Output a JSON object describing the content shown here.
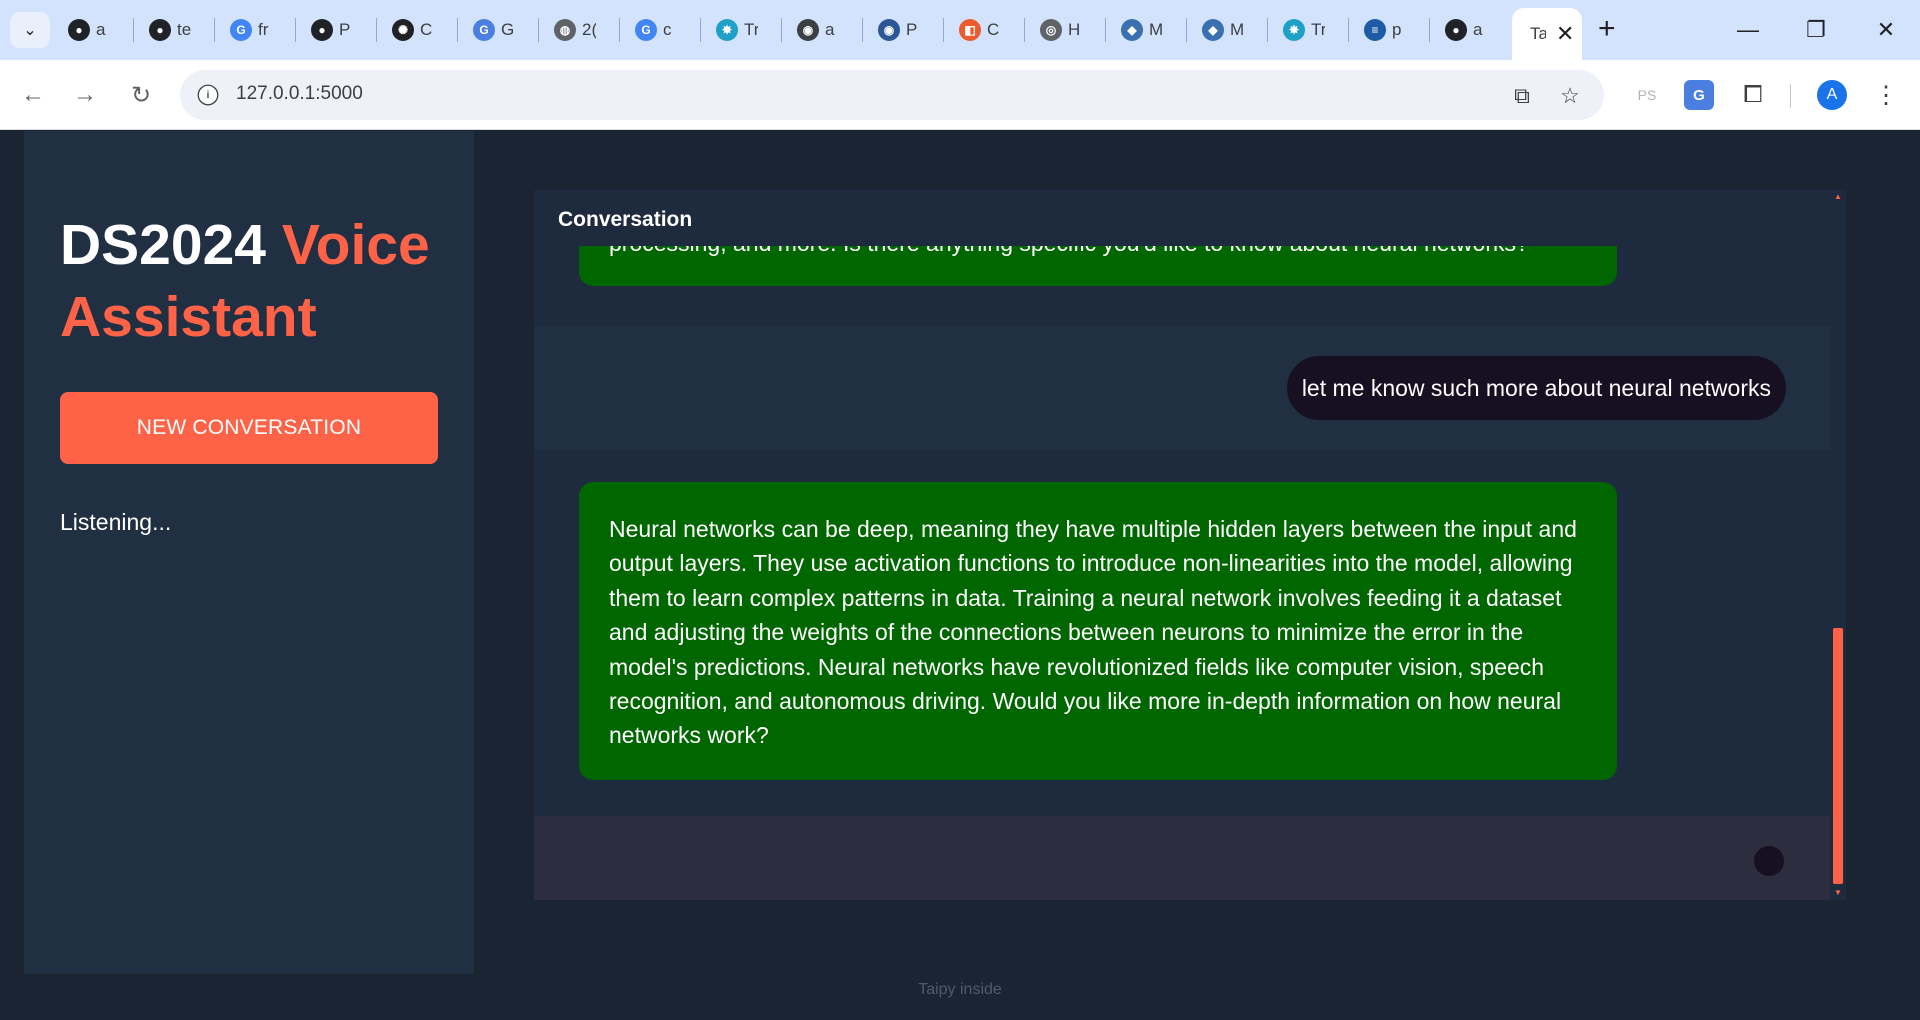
{
  "browser": {
    "tabs": [
      {
        "label": "a",
        "icon": "github-icon",
        "color": "#1f2328"
      },
      {
        "label": "te",
        "icon": "github-icon",
        "color": "#1f2328"
      },
      {
        "label": "fr",
        "icon": "google-icon",
        "color": "#4285f4"
      },
      {
        "label": "P",
        "icon": "github-icon",
        "color": "#1f2328"
      },
      {
        "label": "C",
        "icon": "openai-icon",
        "color": "#202124"
      },
      {
        "label": "G",
        "icon": "translate-icon",
        "color": "#4a7fe0"
      },
      {
        "label": "2(",
        "icon": "globe-icon",
        "color": "#5f6368"
      },
      {
        "label": "c",
        "icon": "google-icon",
        "color": "#4285f4"
      },
      {
        "label": "Tr",
        "icon": "spark-icon",
        "color": "#1fa0c9"
      },
      {
        "label": "a",
        "icon": "generic-icon",
        "color": "#3c4043"
      },
      {
        "label": "P",
        "icon": "generic-icon",
        "color": "#2b5797"
      },
      {
        "label": "C",
        "icon": "office-icon",
        "color": "#eb5b2b"
      },
      {
        "label": "H",
        "icon": "chrome-icon",
        "color": "#5f6368"
      },
      {
        "label": "M",
        "icon": "robot-icon",
        "color": "#3a6fb0"
      },
      {
        "label": "M",
        "icon": "robot-icon",
        "color": "#3a6fb0"
      },
      {
        "label": "Tr",
        "icon": "spark-icon",
        "color": "#1fa0c9"
      },
      {
        "label": "p",
        "icon": "stackoverflow-icon",
        "color": "#1f5aa6"
      },
      {
        "label": "a",
        "icon": "github-icon",
        "color": "#1f2328"
      }
    ],
    "active_tab": {
      "label": "Ta"
    },
    "url": "127.0.0.1:5000",
    "ext_faded": "PS",
    "profile_initial": "A"
  },
  "app": {
    "title_main": "DS2024",
    "title_accent": "Voice Assistant",
    "new_conversation_label": "NEW CONVERSATION",
    "status": "Listening..."
  },
  "conversation": {
    "title": "Conversation",
    "messages": [
      {
        "role": "assistant",
        "text": "processing, and more. Is there anything specific you'd like to know about neural networks?"
      },
      {
        "role": "user",
        "text": "let me know such more about neural networks"
      },
      {
        "role": "assistant",
        "text": "Neural networks can be deep, meaning they have multiple hidden layers between the input and output layers. They use activation functions to introduce non-linearities into the model, allowing them to learn complex patterns in data. Training a neural network involves feeding it a dataset and adjusting the weights of the connections between neurons to minimize the error in the model's predictions. Neural networks have revolutionized fields like computer vision, speech recognition, and autonomous driving. Would you like more in-depth information on how neural networks work?"
      }
    ]
  },
  "footer": {
    "text": "Taipy inside"
  },
  "colors": {
    "accent": "#ff6347",
    "assistant_bubble": "#006600",
    "user_bubble": "#170f22",
    "background": "#1a2433"
  }
}
